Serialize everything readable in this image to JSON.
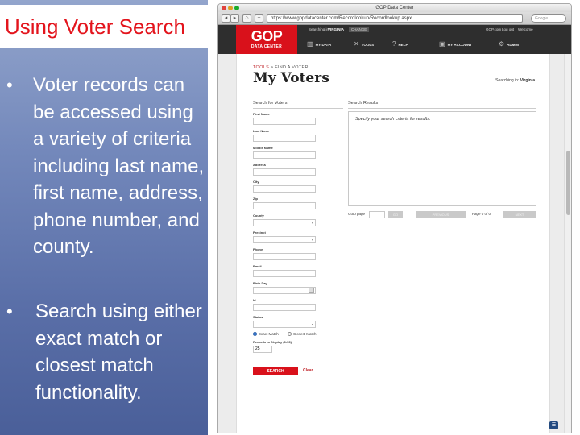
{
  "slide": {
    "title": "Using Voter Search",
    "bullet_glyph": "•",
    "bullets": [
      "Voter records can be accessed using a variety of criteria including last name, first name, address, phone number, and county.",
      "Search using either exact match or closest match functionality."
    ]
  },
  "colors": {
    "title_red": "#e3141c",
    "brand_red": "#d9111b",
    "panel_blue": "#5a6fa8",
    "header_dark": "#2e2e2e"
  },
  "browser": {
    "window_title": "GOP Data Center",
    "url": "https://www.gopdatacenter.com/Recordlookup/Recordlookup.aspx",
    "search_placeholder": "Google",
    "back_icon": "◂",
    "forward_icon": "▸",
    "home_icon": "⌂",
    "add_icon": "+"
  },
  "site": {
    "logo_main": "GOP",
    "logo_sub": "DATA CENTER",
    "top_bar": {
      "searching_in_label": "Searching in:",
      "state": "VIRGINIA",
      "change": "CHANGE",
      "domain": "GOP.com",
      "logout": "Log out",
      "welcome": "Welcome"
    },
    "nav": [
      {
        "label": "MY DATA",
        "icon": "chart-icon",
        "glyph": "▥"
      },
      {
        "label": "TOOLS",
        "icon": "tools-icon",
        "glyph": "✕"
      },
      {
        "label": "HELP",
        "icon": "help-icon",
        "glyph": "?"
      },
      {
        "label": "MY ACCOUNT",
        "icon": "account-icon",
        "glyph": "▣"
      },
      {
        "label": "ADMIN",
        "icon": "admin-icon",
        "glyph": "⚙"
      }
    ]
  },
  "page": {
    "breadcrumb": {
      "parent": "TOOLS",
      "sep": ">",
      "current": "FIND A VOTER"
    },
    "title": "My Voters",
    "searching_in": {
      "prefix": "Searching in:",
      "state": "Virginia"
    },
    "search_form": {
      "heading": "Search for Voters",
      "fields": [
        {
          "label": "First Name",
          "type": "text"
        },
        {
          "label": "Last Name",
          "type": "text"
        },
        {
          "label": "Middle Name",
          "type": "text"
        },
        {
          "label": "Address",
          "type": "text"
        },
        {
          "label": "City",
          "type": "text"
        },
        {
          "label": "Zip",
          "type": "text"
        },
        {
          "label": "County",
          "type": "select"
        },
        {
          "label": "Precinct",
          "type": "select"
        },
        {
          "label": "Phone",
          "type": "text"
        },
        {
          "label": "Email",
          "type": "text"
        },
        {
          "label": "Birth Day",
          "type": "date"
        },
        {
          "label": "Id",
          "type": "text"
        },
        {
          "label": "Status",
          "type": "select"
        }
      ],
      "match_options": [
        {
          "label": "Exact Match",
          "selected": true
        },
        {
          "label": "Closest Match",
          "selected": false
        }
      ],
      "records_label": "Records to Display (0-50)",
      "records_value": "25",
      "search_button": "SEARCH",
      "clear_link": "Clear"
    },
    "results": {
      "heading": "Search Results",
      "placeholder": "Specify your search criteria for results.",
      "goto_label": "Goto page",
      "go_button": "GO",
      "previous_button": "PREVIOUS",
      "page_of": "Page 0 of 0",
      "next_button": "NEXT"
    },
    "chat_glyph": "☰"
  }
}
